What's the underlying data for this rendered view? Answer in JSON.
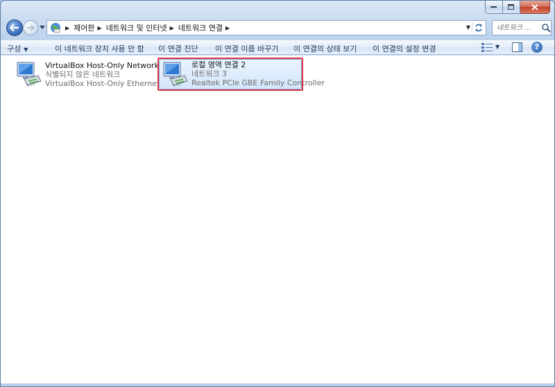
{
  "address": {
    "crumbs": [
      "제어판",
      "네트워크 및 인터넷",
      "네트워크 연결"
    ]
  },
  "search": {
    "placeholder": "네트워크 ..."
  },
  "toolbar": {
    "organize": "구성",
    "disable_device": "이 네트워크 장치 사용 안 함",
    "diagnose": "이 연결 진단",
    "rename": "이 연결 이름 바꾸기",
    "view_status": "이 연결의 상태 보기",
    "change_settings": "이 연결의 설정 변경",
    "help": "?"
  },
  "connections": [
    {
      "name": "VirtualBox Host-Only Network",
      "status": "식별되지 않은 네트워크",
      "device": "VirtualBox Host-Only Ethernet A..."
    },
    {
      "name": "로컬 영역 연결 2",
      "status": "네트워크  3",
      "device": "Realtek PCIe GBE Family Controller"
    }
  ],
  "colors": {
    "selection_highlight": "#e03546",
    "title_gradient": "#cadcf1"
  }
}
